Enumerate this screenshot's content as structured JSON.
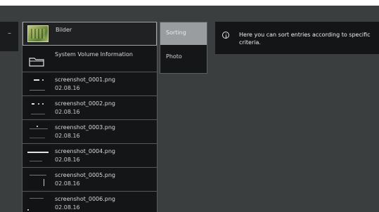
{
  "file_list": {
    "folders": [
      {
        "name": "Bilder",
        "icon": "image-folder-icon"
      },
      {
        "name": "System Volume Information",
        "icon": "folder-icon"
      }
    ],
    "files": [
      {
        "name": "screenshot_0001.png",
        "date": "02.08.16",
        "icon": "screenshot-thumbnail-icon"
      },
      {
        "name": "screenshot_0002.png",
        "date": "02.08.16",
        "icon": "screenshot-thumbnail-icon"
      },
      {
        "name": "screenshot_0003.png",
        "date": "02.08.16",
        "icon": "screenshot-thumbnail-icon"
      },
      {
        "name": "screenshot_0004.png",
        "date": "02.08.16",
        "icon": "screenshot-thumbnail-icon"
      },
      {
        "name": "screenshot_0005.png",
        "date": "02.08.16",
        "icon": "screenshot-thumbnail-icon"
      },
      {
        "name": "screenshot_0006.png",
        "date": "02.08.16",
        "icon": "screenshot-thumbnail-icon"
      }
    ]
  },
  "sort_menu": {
    "options": [
      {
        "label": "Sorting",
        "selected": true
      },
      {
        "label": "Photo",
        "selected": false
      }
    ]
  },
  "tooltip": {
    "icon": "info-icon",
    "text": "Here you can sort entries according to specific criteria."
  },
  "previous_column": {
    "glyph": "–"
  },
  "colors": {
    "background": "#3b3e3e",
    "panel": "#141516",
    "highlight": "#9a9d9f",
    "text": "#d9dadb"
  }
}
